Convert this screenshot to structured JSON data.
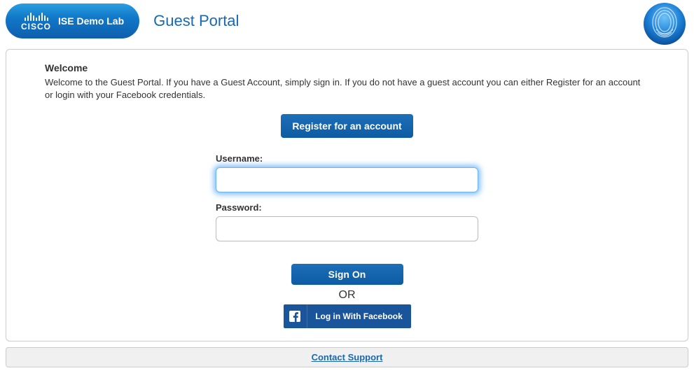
{
  "header": {
    "brand": "CISCO",
    "lab": "ISE Demo Lab",
    "title": "Guest Portal"
  },
  "main": {
    "welcome_heading": "Welcome",
    "welcome_text": "Welcome to the Guest Portal. If you have a Guest Account, simply sign in.  If you do not have a guest account you can either Register for an account or login with your Facebook credentials.",
    "register_label": "Register for an account",
    "username_label": "Username:",
    "username_value": "",
    "password_label": "Password:",
    "password_value": "",
    "signon_label": "Sign On",
    "or_text": "OR",
    "facebook_label": "Log in With Facebook"
  },
  "footer": {
    "contact_label": "Contact Support"
  },
  "colors": {
    "primary": "#1968b3",
    "button_bg": "#0d5ba3",
    "fb_bg": "#1a559c"
  }
}
